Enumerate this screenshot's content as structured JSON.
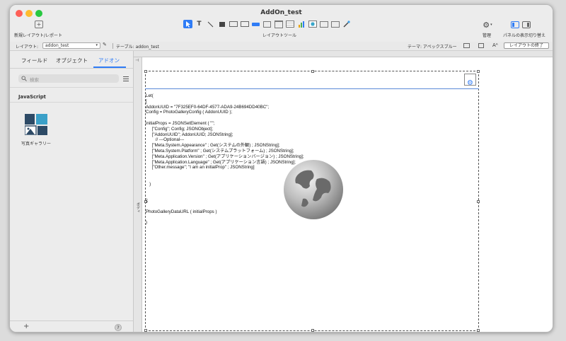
{
  "window": {
    "title": "AddOn_test",
    "colors": {
      "close": "#fe5f57",
      "minimize": "#febc2e",
      "zoom": "#28c840"
    }
  },
  "toolbar": {
    "new_layout_label": "新規レイアウト/レポート",
    "layout_tools_label": "レイアウトツール",
    "manage_label": "管理",
    "panel_toggle_label": "パネルの表示切り替え"
  },
  "layoutbar": {
    "layout_prefix": "レイアウト:",
    "layout_name": "addon_test",
    "table_text": "テーブル: addon_test",
    "theme_text": "テーマ: アペックスブルー",
    "exit_layout_label": "レイアウトの終了"
  },
  "sidebar": {
    "tabs": [
      {
        "label": "フィールド"
      },
      {
        "label": "オブジェクト"
      },
      {
        "label": "アドオン"
      }
    ],
    "search_placeholder": "検索",
    "section_title": "JavaScript",
    "addon_item_label": "写真ギャラリー",
    "add_label": "+",
    "help_label": "?"
  },
  "canvas": {
    "part_label": "ボディ",
    "code_lines": [
      "Let(",
      "[",
      "AddonUUID = \"7F325EF0-64DF-4577-ADA9-24B694DD40BC\";",
      "Config = PhotoGalleryConfig ( AddonUUID );",
      "",
      "initialProps = JSONSetElement ( \"\";",
      "     [\"Config\"; Config; JSONObject];",
      "     [\"AddonUUID\"; AddonUUID; JSONString];",
      "        // ---Optional---",
      "     [\"Meta.System.Appearance\" ; Get(システムの外観) ; JSONString];",
      "     [\"Meta.System.Platform\" ; Get(システムプラットフォーム) ; JSONString];",
      "     [\"Meta.Application.Version\" ; Get(アプリケーションバージョン) ; JSONString];",
      "     [\"Meta.Application.Language\" ; Get(アプリケーション言語) ; JSONString];",
      "     [\"Other.message\"; \"I am an initialProp\" ; JSONString]",
      "",
      "",
      "   )",
      "",
      "",
      "];",
      "",
      "PhotoGalleryDataURL ( initialProps )",
      "",
      ")"
    ]
  }
}
